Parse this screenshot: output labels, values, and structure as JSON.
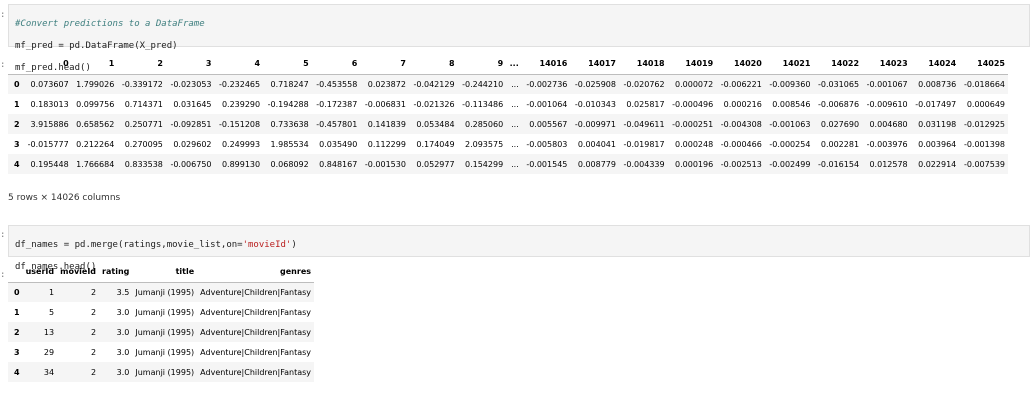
{
  "cell1": {
    "prompt": ":",
    "lines": [
      {
        "type": "comment",
        "text": "#Convert predictions to a DataFrame"
      },
      {
        "type": "code",
        "text": "mf_pred = pd.DataFrame(X_pred)"
      },
      {
        "type": "code",
        "text": "mf_pred.head()"
      }
    ]
  },
  "out1": {
    "prompt": ":",
    "columns": [
      "",
      "0",
      "1",
      "2",
      "3",
      "4",
      "5",
      "6",
      "7",
      "8",
      "9",
      "...",
      "14016",
      "14017",
      "14018",
      "14019",
      "14020",
      "14021",
      "14022",
      "14023",
      "14024",
      "14025"
    ],
    "rows": [
      [
        "0",
        "0.073607",
        "1.799026",
        "-0.339172",
        "-0.023053",
        "-0.232465",
        "0.718247",
        "-0.453558",
        "0.023872",
        "-0.042129",
        "-0.244210",
        "...",
        "-0.002736",
        "-0.025908",
        "-0.020762",
        "0.000072",
        "-0.006221",
        "-0.009360",
        "-0.031065",
        "-0.001067",
        "0.008736",
        "-0.018664"
      ],
      [
        "1",
        "0.183013",
        "0.099756",
        "0.714371",
        "0.031645",
        "0.239290",
        "-0.194288",
        "-0.172387",
        "-0.006831",
        "-0.021326",
        "-0.113486",
        "...",
        "-0.001064",
        "-0.010343",
        "0.025817",
        "-0.000496",
        "0.000216",
        "0.008546",
        "-0.006876",
        "-0.009610",
        "-0.017497",
        "0.000649"
      ],
      [
        "2",
        "3.915886",
        "0.658562",
        "0.250771",
        "-0.092851",
        "-0.151208",
        "0.733638",
        "-0.457801",
        "0.141839",
        "0.053484",
        "0.285060",
        "...",
        "0.005567",
        "-0.009971",
        "-0.049611",
        "-0.000251",
        "-0.004308",
        "-0.001063",
        "0.027690",
        "0.004680",
        "0.031198",
        "-0.012925"
      ],
      [
        "3",
        "-0.015777",
        "0.212264",
        "0.270095",
        "0.029602",
        "0.249993",
        "1.985534",
        "0.035490",
        "0.112299",
        "0.174049",
        "2.093575",
        "...",
        "-0.005803",
        "0.004041",
        "-0.019817",
        "0.000248",
        "-0.000466",
        "-0.000254",
        "0.002281",
        "-0.003976",
        "0.003964",
        "-0.001398"
      ],
      [
        "4",
        "0.195448",
        "1.766684",
        "0.833538",
        "-0.006750",
        "0.899130",
        "0.068092",
        "0.848167",
        "-0.001530",
        "0.052977",
        "0.154299",
        "...",
        "-0.001545",
        "0.008779",
        "-0.004339",
        "0.000196",
        "-0.002513",
        "-0.002499",
        "-0.016154",
        "0.012578",
        "0.022914",
        "-0.007539"
      ]
    ],
    "shape": "5 rows × 14026 columns"
  },
  "cell2": {
    "prompt": ":",
    "line1_pre": "df_names = pd.merge(ratings,movie_list,on=",
    "line1_str": "'movieId'",
    "line1_post": ")",
    "line2": "df_names.head()"
  },
  "out2": {
    "prompt": ":",
    "columns": [
      "",
      "userId",
      "movieId",
      "rating",
      "title",
      "genres"
    ],
    "rows": [
      [
        "0",
        "1",
        "2",
        "3.5",
        "Jumanji (1995)",
        "Adventure|Children|Fantasy"
      ],
      [
        "1",
        "5",
        "2",
        "3.0",
        "Jumanji (1995)",
        "Adventure|Children|Fantasy"
      ],
      [
        "2",
        "13",
        "2",
        "3.0",
        "Jumanji (1995)",
        "Adventure|Children|Fantasy"
      ],
      [
        "3",
        "29",
        "2",
        "3.0",
        "Jumanji (1995)",
        "Adventure|Children|Fantasy"
      ],
      [
        "4",
        "34",
        "2",
        "3.0",
        "Jumanji (1995)",
        "Adventure|Children|Fantasy"
      ]
    ]
  }
}
